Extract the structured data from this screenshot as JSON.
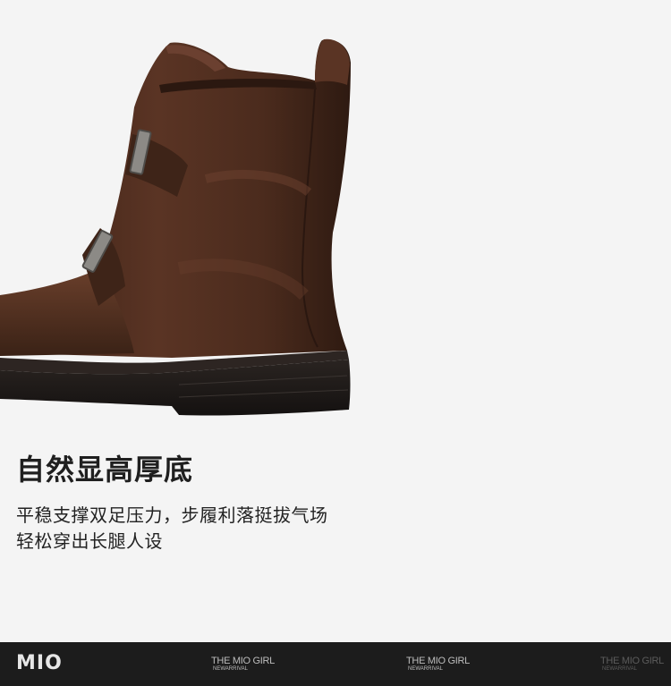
{
  "headline": "自然显高厚底",
  "description": {
    "line1": "平稳支撑双足压力，步履利落挺拔气场",
    "line2": "轻松穿出长腿人设"
  },
  "footer": {
    "logo": "MIO",
    "tags": [
      {
        "title": "THE MIO GIRL",
        "subtitle": "NEWARRIVAL"
      },
      {
        "title": "THE MIO GIRL",
        "subtitle": "NEWARRIVAL"
      },
      {
        "title": "THE MIO GIRL",
        "subtitle": "NEWARRIVAL"
      }
    ]
  },
  "colors": {
    "background": "#f4f4f4",
    "leather": "#4a2a1c",
    "sole": "#1e1a18",
    "footer": "#1c1c1c"
  },
  "image": {
    "subject": "brown leather buckle ankle boot with thick sole"
  }
}
